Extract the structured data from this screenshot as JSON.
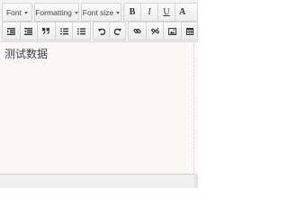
{
  "toolbar": {
    "font_label": "Font",
    "formatting_label": "Formatting",
    "font_size_label": "Font size",
    "bold_label": "B",
    "italic_label": "I",
    "underline_label": "U",
    "text_color_label": "A"
  },
  "icons": [
    "align-left-icon",
    "align-right-icon",
    "blockquote-icon",
    "ordered-list-icon",
    "unordered-list-icon",
    "undo-icon",
    "redo-icon",
    "link-icon",
    "unlink-icon",
    "image-icon",
    "table-icon"
  ],
  "content": {
    "text": "测试数据"
  },
  "colors": {
    "toolbar_bg": "#f4f4f4",
    "content_bg": "#fcf8f8",
    "border": "#d4d4d4"
  }
}
